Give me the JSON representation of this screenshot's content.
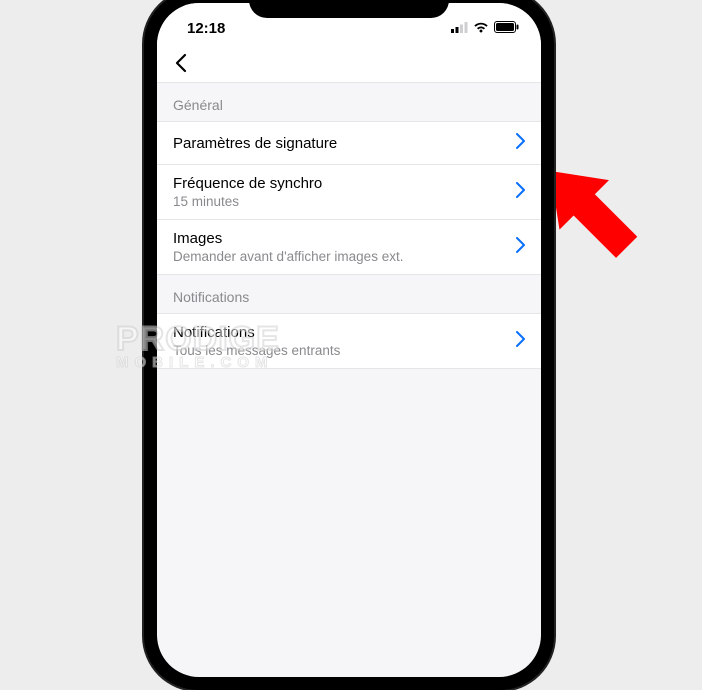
{
  "status": {
    "time": "12:18"
  },
  "sections": {
    "general": {
      "header": "Général",
      "signature": {
        "title": "Paramètres de signature"
      },
      "sync": {
        "title": "Fréquence de synchro",
        "value": "15 minutes"
      },
      "images": {
        "title": "Images",
        "value": "Demander avant d'afficher images ext."
      }
    },
    "notifications": {
      "header": "Notifications",
      "notifications": {
        "title": "Notifications",
        "value": "Tous les messages entrants"
      }
    }
  },
  "watermark": {
    "line1": "PRODIGE",
    "line2": "MOBILE.COM"
  },
  "annotation": {
    "color": "#ff0000"
  },
  "colors": {
    "chevron": "#0a6fff"
  }
}
